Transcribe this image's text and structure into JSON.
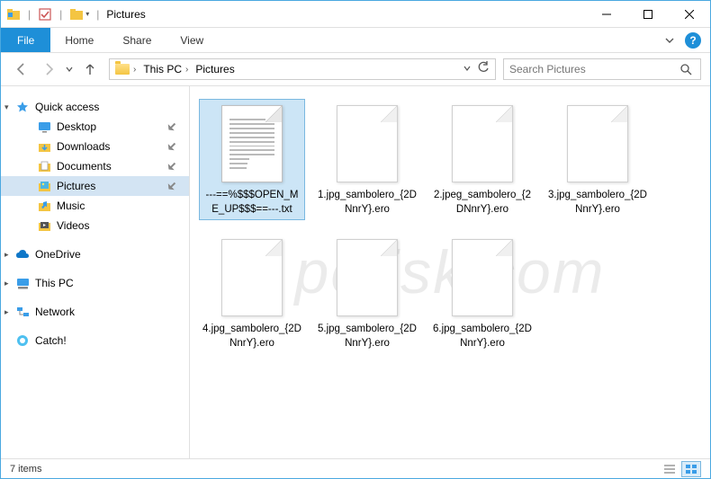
{
  "title": "Pictures",
  "ribbon": {
    "file": "File",
    "tabs": [
      "Home",
      "Share",
      "View"
    ]
  },
  "breadcrumb": [
    "This PC",
    "Pictures"
  ],
  "search": {
    "placeholder": "Search Pictures"
  },
  "sidebar": {
    "quick_access": {
      "label": "Quick access"
    },
    "quick_items": [
      {
        "label": "Desktop"
      },
      {
        "label": "Downloads"
      },
      {
        "label": "Documents"
      },
      {
        "label": "Pictures"
      },
      {
        "label": "Music"
      },
      {
        "label": "Videos"
      }
    ],
    "onedrive": {
      "label": "OneDrive"
    },
    "thispc": {
      "label": "This PC"
    },
    "network": {
      "label": "Network"
    },
    "catch": {
      "label": "Catch!"
    }
  },
  "files": [
    {
      "name": "---==%$$$OPEN_ME_UP$$$==---.txt",
      "type": "txt",
      "selected": true
    },
    {
      "name": "1.jpg_sambolero_{2DNnrY}.ero",
      "type": "blank"
    },
    {
      "name": "2.jpeg_sambolero_{2DNnrY}.ero",
      "type": "blank"
    },
    {
      "name": "3.jpg_sambolero_{2DNnrY}.ero",
      "type": "blank"
    },
    {
      "name": "4.jpg_sambolero_{2DNnrY}.ero",
      "type": "blank"
    },
    {
      "name": "5.jpg_sambolero_{2DNnrY}.ero",
      "type": "blank"
    },
    {
      "name": "6.jpg_sambolero_{2DNnrY}.ero",
      "type": "blank"
    }
  ],
  "status": {
    "count_label": "7 items"
  },
  "watermark": "pcrisk.com"
}
